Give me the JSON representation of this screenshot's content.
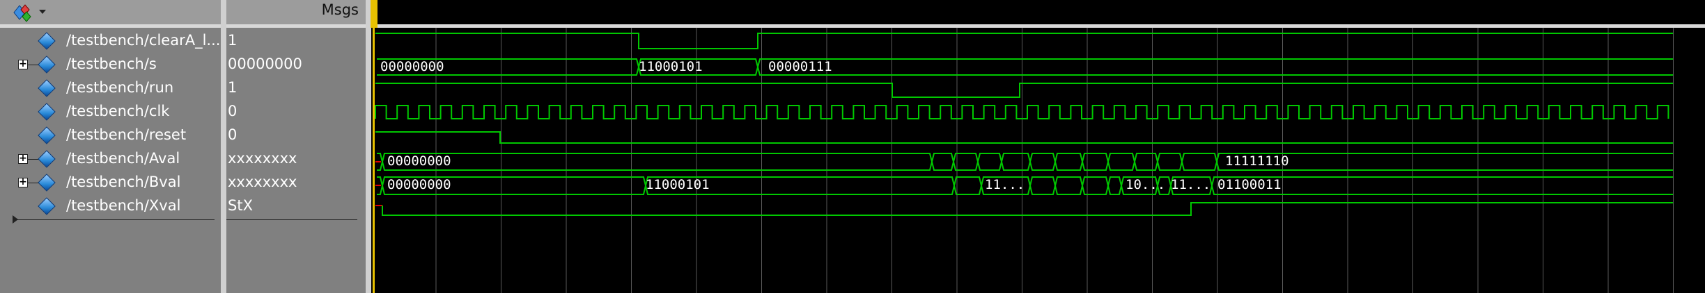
{
  "toolbar": {
    "menu_icon": "wave-tool-icon",
    "msgs_header": "Msgs"
  },
  "colors": {
    "wave": "#00c800",
    "grid": "#5a5a5a",
    "cursor": "#e8c100",
    "unknown": "#e00000"
  },
  "signals": [
    {
      "name": "/testbench/clearA_l...",
      "value": "1",
      "expandable": false
    },
    {
      "name": "/testbench/s",
      "value": "00000000",
      "expandable": true
    },
    {
      "name": "/testbench/run",
      "value": "1",
      "expandable": false
    },
    {
      "name": "/testbench/clk",
      "value": "0",
      "expandable": false
    },
    {
      "name": "/testbench/reset",
      "value": "0",
      "expandable": false
    },
    {
      "name": "/testbench/Aval",
      "value": "xxxxxxxx",
      "expandable": true
    },
    {
      "name": "/testbench/Bval",
      "value": "xxxxxxxx",
      "expandable": true
    },
    {
      "name": "/testbench/Xval",
      "value": "StX",
      "expandable": false
    }
  ],
  "waves": {
    "s_labels": [
      "00000000",
      "11000101",
      "00000111"
    ],
    "aval_labels": [
      "00000000",
      "11111110"
    ],
    "bval_labels": [
      "00000000",
      "11000101",
      "11...",
      "10...",
      "11...",
      "01100011"
    ]
  }
}
